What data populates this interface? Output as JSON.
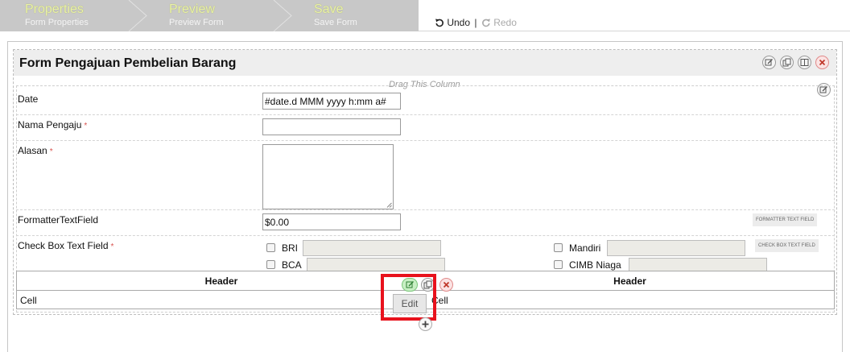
{
  "wizard": {
    "steps": [
      {
        "title": "Properties",
        "subtitle": "Form Properties"
      },
      {
        "title": "Preview",
        "subtitle": "Preview Form"
      },
      {
        "title": "Save",
        "subtitle": "Save Form"
      }
    ]
  },
  "toolbar": {
    "undo_label": "Undo",
    "separator": "|",
    "redo_label": "Redo"
  },
  "form": {
    "title": "Form Pengajuan Pembelian Barang",
    "drag_hint": "Drag This Column",
    "fields": {
      "date": {
        "label": "Date",
        "value": "#date.d MMM yyyy h:mm a#"
      },
      "nama": {
        "label": "Nama Pengaju",
        "required_mark": "*",
        "value": ""
      },
      "alasan": {
        "label": "Alasan",
        "required_mark": "*",
        "value": ""
      },
      "formatter": {
        "label": "FormatterTextField",
        "value": "$0.00",
        "type_tag": "FORMATTER TEXT FIELD"
      },
      "checkbox": {
        "label": "Check Box Text Field",
        "required_mark": "*",
        "type_tag": "CHECK BOX TEXT FIELD",
        "options": [
          "BRI",
          "BCA",
          "Mandiri",
          "CIMB Niaga"
        ]
      }
    },
    "grid": {
      "headers": [
        "Header",
        "Header"
      ],
      "cells": [
        "Cell",
        "Cell"
      ]
    },
    "tooltip": "Edit"
  }
}
